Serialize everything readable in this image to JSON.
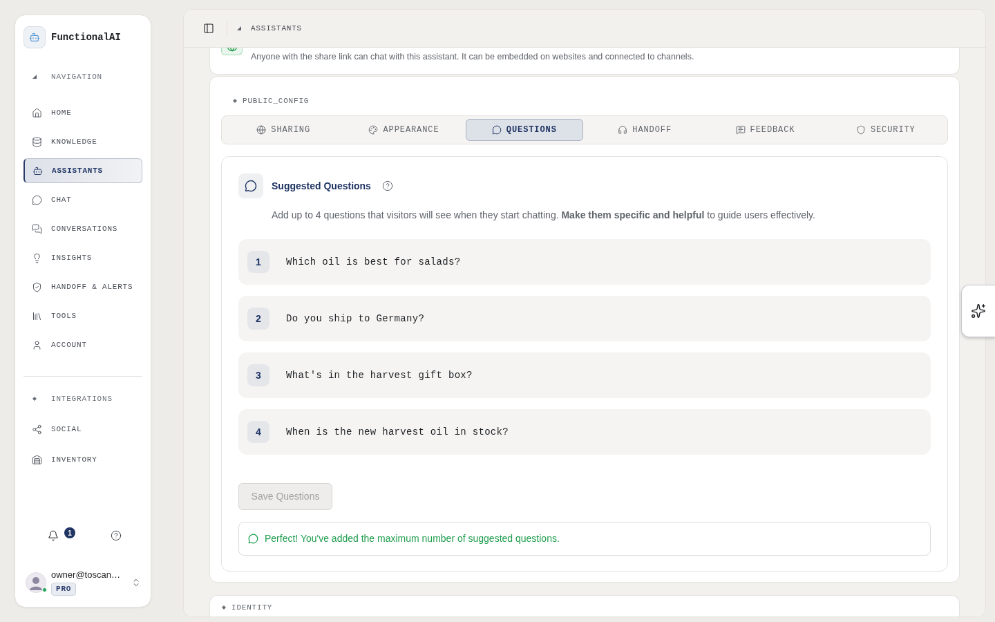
{
  "sidebar": {
    "brand": "FunctionalAI",
    "sections": [
      {
        "label": "NAVIGATION",
        "items": [
          {
            "label": "HOME",
            "selected": false
          },
          {
            "label": "KNOWLEDGE",
            "selected": false
          },
          {
            "label": "ASSISTANTS",
            "selected": true
          },
          {
            "label": "CHAT",
            "selected": false
          },
          {
            "label": "CONVERSATIONS",
            "selected": false
          },
          {
            "label": "INSIGHTS",
            "selected": false
          },
          {
            "label": "HANDOFF & ALERTS",
            "selected": false
          },
          {
            "label": "TOOLS",
            "selected": false
          },
          {
            "label": "ACCOUNT",
            "selected": false
          }
        ]
      },
      {
        "label": "INTEGRATIONS",
        "items": [
          {
            "label": "SOCIAL",
            "selected": false
          },
          {
            "label": "INVENTORY",
            "selected": false
          }
        ]
      }
    ],
    "notifications": {
      "count": "1"
    },
    "user": {
      "email": "owner@toscan…",
      "plan": "PRO",
      "online": true
    }
  },
  "header": {
    "breadcrumb": "ASSISTANTS"
  },
  "share_card": {
    "description": "Anyone with the share link can chat with this assistant. It can be embedded on websites and connected to channels."
  },
  "public_config": {
    "label": "PUBLIC_CONFIG",
    "tabs": [
      {
        "label": "SHARING",
        "selected": false
      },
      {
        "label": "APPEARANCE",
        "selected": false
      },
      {
        "label": "QUESTIONS",
        "selected": true
      },
      {
        "label": "HANDOFF",
        "selected": false
      },
      {
        "label": "FEEDBACK",
        "selected": false
      },
      {
        "label": "SECURITY",
        "selected": false
      }
    ],
    "panel": {
      "title": "Suggested Questions",
      "description": "Add up to 4 questions that visitors will see when they start chatting. **Make them specific and helpful** to guide users effectively.",
      "questions": [
        {
          "number": "1",
          "value": "Which oil is best for salads?"
        },
        {
          "number": "2",
          "value": "Do you ship to Germany?"
        },
        {
          "number": "3",
          "value": "What's in the harvest gift box?"
        },
        {
          "number": "4",
          "value": "When is the new harvest oil in stock?"
        }
      ],
      "save_button": {
        "label": "Save Questions",
        "disabled": true
      },
      "success_message": "Perfect! You've added the maximum number of suggested questions."
    }
  },
  "identity_card": {
    "label": "IDENTITY"
  }
}
